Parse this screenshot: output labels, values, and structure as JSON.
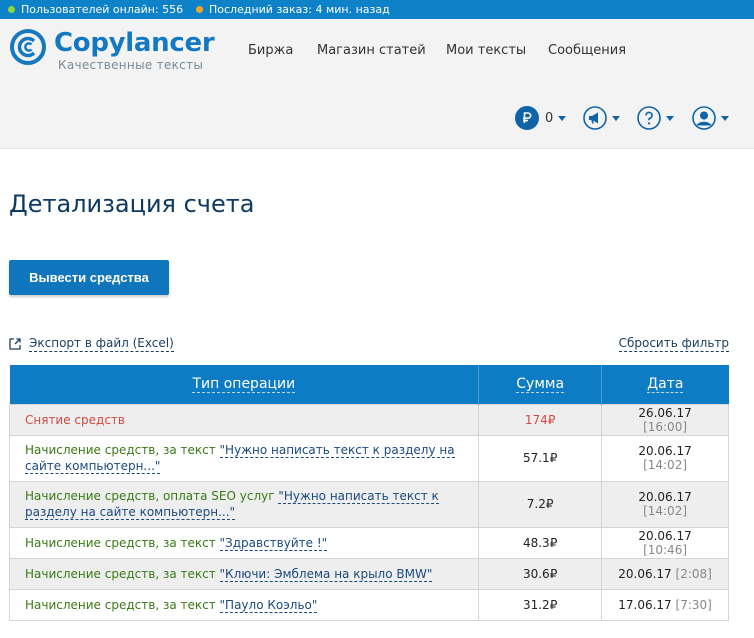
{
  "topbar": {
    "users_online": "Пользователей онлайн: 556",
    "last_order": "Последний заказ: 4 мин. назад",
    "users_dot_color": "#8fd43a",
    "order_dot_color": "#f5a623"
  },
  "brand": {
    "name": "Copylancer",
    "tagline": "Качественные тексты",
    "color": "#1579c2"
  },
  "nav": {
    "items": [
      "Биржа",
      "Магазин статей",
      "Мои тексты",
      "Сообщения"
    ]
  },
  "toolbar": {
    "balance_icon": "ruble-icon",
    "balance": "0",
    "announcements_icon": "megaphone-icon",
    "help_icon": "help-icon",
    "profile_icon": "user-icon"
  },
  "page": {
    "title": "Детализация счета",
    "withdraw_label": "Вывести средства",
    "export_label": "Экспорт в файл (Excel)",
    "reset_filter_label": "Сбросить фильтр"
  },
  "table": {
    "headers": [
      "Тип операции",
      "Сумма",
      "Дата"
    ],
    "rows": [
      {
        "type": "Снятие средств",
        "link": "",
        "amount": "174",
        "date": "26.06.17",
        "time": "[16:00]"
      },
      {
        "type": "Начисление средств, за текст",
        "link": "\"Нужно написать текст к разделу на сайте компьютерн...\"",
        "amount": "57.1",
        "date": "20.06.17",
        "time": "[14:02]"
      },
      {
        "type": "Начисление средств, оплата SEO услуг",
        "link": "\"Нужно написать текст к разделу на сайте компьютерн...\"",
        "amount": "7.2",
        "date": "20.06.17",
        "time": "[14:02]"
      },
      {
        "type": "Начисление средств, за текст",
        "link": "\"Здравствуйте !\"",
        "amount": "48.3",
        "date": "20.06.17",
        "time": "[10:46]"
      },
      {
        "type": "Начисление средств, за текст",
        "link": "\"Ключи: Эмблема на крыло BMW\"",
        "amount": "30.6",
        "date": "20.06.17",
        "time": "[2:08]"
      },
      {
        "type": "Начисление средств, за текст",
        "link": "\"Пауло Коэльо\"",
        "amount": "31.2",
        "date": "17.06.17",
        "time": "[7:30]"
      }
    ],
    "currency": "₽"
  },
  "colors": {
    "accent": "#0e7cc5",
    "credit": "#3a7a16",
    "debit": "#d04a43"
  }
}
